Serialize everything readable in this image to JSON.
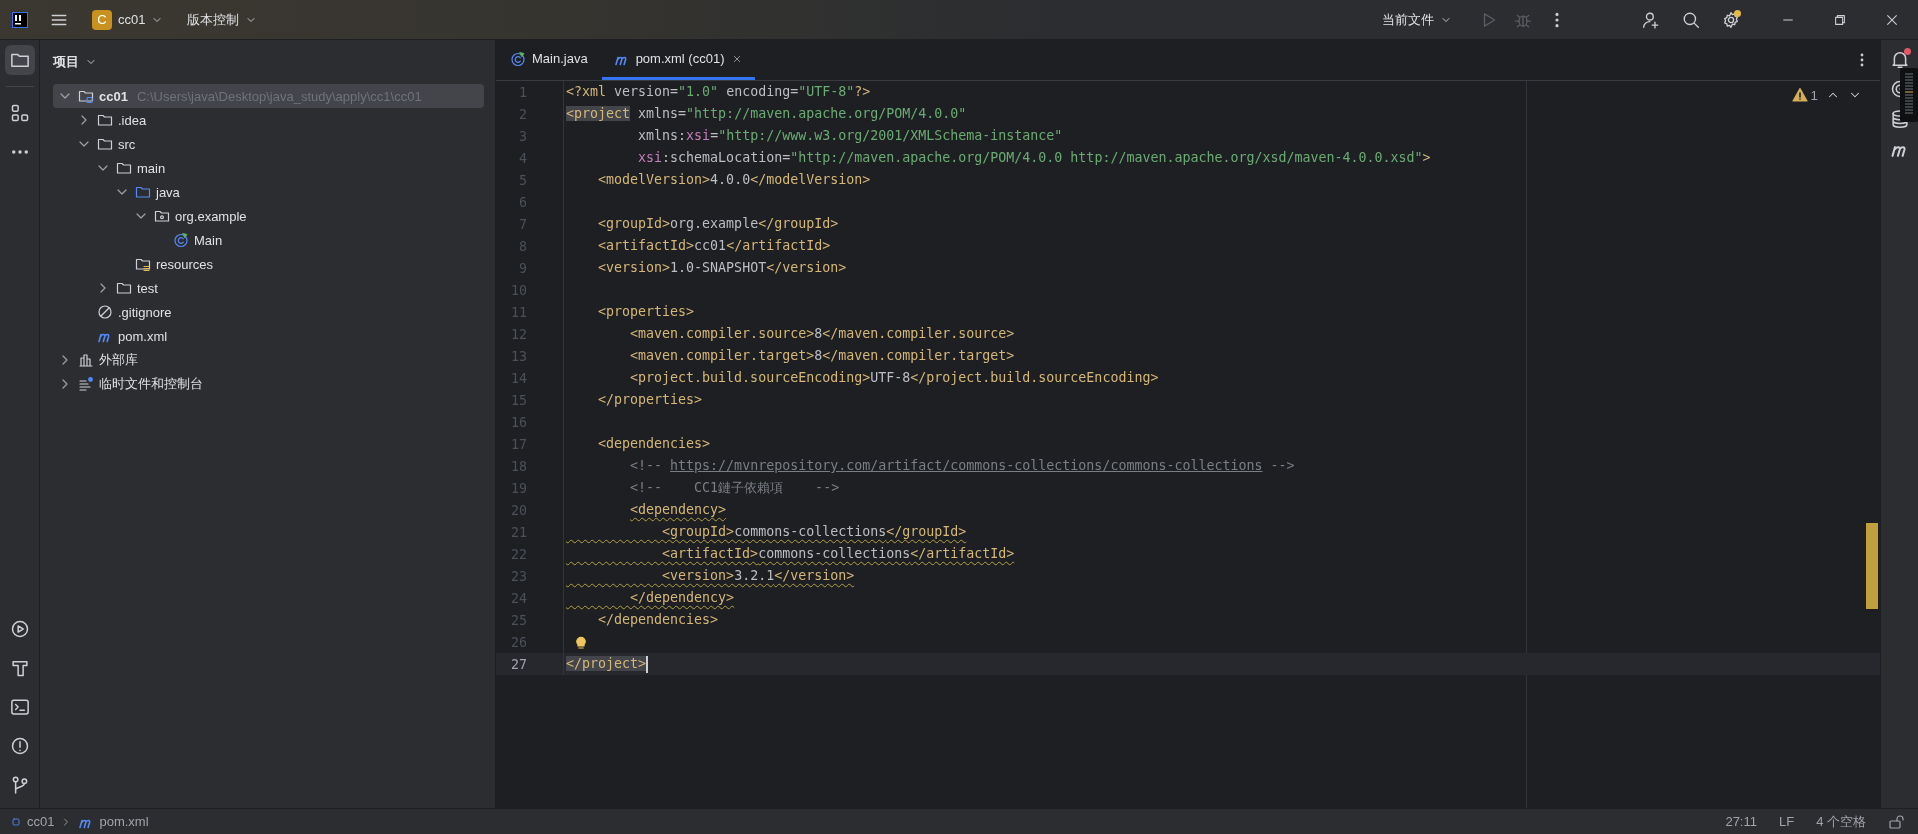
{
  "title_bar": {
    "project": {
      "badge": "C",
      "name": "cc01"
    },
    "vcs_menu": "版本控制",
    "run_config": "当前文件",
    "run_enabled": false,
    "settings_update": true
  },
  "project_panel": {
    "title": "项目",
    "open": true,
    "tree": [
      {
        "kind": "module",
        "label": "cc01",
        "path": "C:\\Users\\java\\Desktop\\java_study\\apply\\cc1\\cc01",
        "expanded": true,
        "selected": true,
        "children": [
          {
            "kind": "folder",
            "label": ".idea",
            "expanded": false,
            "selected": false
          },
          {
            "kind": "folder",
            "label": "src",
            "expanded": true,
            "selected": false,
            "children": [
              {
                "kind": "folder",
                "label": "main",
                "expanded": true,
                "selected": false,
                "children": [
                  {
                    "kind": "source",
                    "label": "java",
                    "expanded": true,
                    "selected": false,
                    "children": [
                      {
                        "kind": "package",
                        "label": "org.example",
                        "expanded": true,
                        "selected": false,
                        "children": [
                          {
                            "kind": "class",
                            "label": "Main",
                            "selected": false
                          }
                        ]
                      }
                    ]
                  },
                  {
                    "kind": "resources",
                    "label": "resources",
                    "selected": false
                  }
                ]
              },
              {
                "kind": "folder",
                "label": "test",
                "expanded": false,
                "selected": false
              }
            ]
          },
          {
            "kind": "gitignore",
            "label": ".gitignore",
            "selected": false
          },
          {
            "kind": "maven",
            "label": "pom.xml",
            "selected": false
          }
        ]
      },
      {
        "kind": "library",
        "label": "外部库",
        "expanded": false,
        "selected": false
      },
      {
        "kind": "scratch",
        "label": "临时文件和控制台",
        "expanded": false,
        "selected": false
      }
    ]
  },
  "editor": {
    "tabs": [
      {
        "kind": "class",
        "label": "Main.java",
        "selected": false,
        "closable": false
      },
      {
        "kind": "maven",
        "label": "pom.xml (cc01)",
        "selected": true,
        "closable": true
      }
    ],
    "warnings": "1",
    "lines": [
      {
        "number": "1",
        "current": false,
        "tokens": [
          {
            "kind": "tag",
            "text": "<?xml "
          },
          {
            "kind": "attr",
            "text": "version="
          },
          {
            "kind": "value",
            "text": "\"1.0\""
          },
          {
            "kind": "attr",
            "text": " encoding="
          },
          {
            "kind": "value",
            "text": "\"UTF-8\""
          },
          {
            "kind": "tag",
            "text": "?>"
          }
        ]
      },
      {
        "number": "2",
        "current": false,
        "tokens": [
          {
            "kind": "tag",
            "text": "<project",
            "match": true
          },
          {
            "kind": "attr",
            "text": " xmlns="
          },
          {
            "kind": "value",
            "text": "\"http://maven.apache.org/POM/4.0.0\""
          }
        ]
      },
      {
        "number": "3",
        "current": false,
        "tokens": [
          {
            "kind": "attr",
            "text": "         xmlns:"
          },
          {
            "kind": "ns",
            "text": "xsi"
          },
          {
            "kind": "attr",
            "text": "="
          },
          {
            "kind": "value",
            "text": "\"http://www.w3.org/2001/XMLSchema-instance\""
          }
        ]
      },
      {
        "number": "4",
        "current": false,
        "tokens": [
          {
            "kind": "ns",
            "text": "         xsi"
          },
          {
            "kind": "attr",
            "text": ":schemaLocation="
          },
          {
            "kind": "value",
            "text": "\"http://maven.apache.org/POM/4.0.0 http://maven.apache.org/xsd/maven-4.0.0.xsd\""
          },
          {
            "kind": "tag",
            "text": ">"
          }
        ]
      },
      {
        "number": "5",
        "current": false,
        "tokens": [
          {
            "kind": "tag",
            "text": "    <modelVersion>"
          },
          {
            "kind": "text",
            "text": "4.0.0"
          },
          {
            "kind": "tag",
            "text": "</modelVersion>"
          }
        ]
      },
      {
        "number": "6",
        "current": false
      },
      {
        "number": "7",
        "current": false,
        "tokens": [
          {
            "kind": "tag",
            "text": "    <groupId>"
          },
          {
            "kind": "text",
            "text": "org.example"
          },
          {
            "kind": "tag",
            "text": "</groupId>"
          }
        ]
      },
      {
        "number": "8",
        "current": false,
        "tokens": [
          {
            "kind": "tag",
            "text": "    <artifactId>"
          },
          {
            "kind": "text",
            "text": "cc01"
          },
          {
            "kind": "tag",
            "text": "</artifactId>"
          }
        ]
      },
      {
        "number": "9",
        "current": false,
        "tokens": [
          {
            "kind": "tag",
            "text": "    <version>"
          },
          {
            "kind": "text",
            "text": "1.0-SNAPSHOT"
          },
          {
            "kind": "tag",
            "text": "</version>"
          }
        ]
      },
      {
        "number": "10",
        "current": false
      },
      {
        "number": "11",
        "current": false,
        "tokens": [
          {
            "kind": "tag",
            "text": "    <properties>"
          }
        ]
      },
      {
        "number": "12",
        "current": false,
        "tokens": [
          {
            "kind": "tag",
            "text": "        <maven.compiler.source>"
          },
          {
            "kind": "text",
            "text": "8"
          },
          {
            "kind": "tag",
            "text": "</maven.compiler.source>"
          }
        ]
      },
      {
        "number": "13",
        "current": false,
        "tokens": [
          {
            "kind": "tag",
            "text": "        <maven.compiler.target>"
          },
          {
            "kind": "text",
            "text": "8"
          },
          {
            "kind": "tag",
            "text": "</maven.compiler.target>"
          }
        ]
      },
      {
        "number": "14",
        "current": false,
        "tokens": [
          {
            "kind": "tag",
            "text": "        <project.build.sourceEncoding>"
          },
          {
            "kind": "text",
            "text": "UTF-8"
          },
          {
            "kind": "tag",
            "text": "</project.build.sourceEncoding>"
          }
        ]
      },
      {
        "number": "15",
        "current": false,
        "tokens": [
          {
            "kind": "tag",
            "text": "    </properties>"
          }
        ]
      },
      {
        "number": "16",
        "current": false
      },
      {
        "number": "17",
        "current": false,
        "tokens": [
          {
            "kind": "tag",
            "text": "    <dependencies>"
          }
        ]
      },
      {
        "number": "18",
        "current": false,
        "tokens": [
          {
            "kind": "comment",
            "text": "        <!-- "
          },
          {
            "kind": "link",
            "text": "https://mvnrepository.com/artifact/commons-collections/commons-collections"
          },
          {
            "kind": "comment",
            "text": " -->"
          }
        ]
      },
      {
        "number": "19",
        "current": false,
        "tokens": [
          {
            "kind": "comment",
            "text": "        <!--    CC1鏈子依賴項    -->"
          }
        ]
      },
      {
        "number": "20",
        "current": false,
        "tokens": [
          {
            "kind": "tag",
            "text": "        <dependency>",
            "warning": true
          }
        ]
      },
      {
        "number": "21",
        "current": false,
        "tokens": [
          {
            "kind": "tag",
            "text": "            <groupId>",
            "warning": true
          },
          {
            "kind": "text",
            "text": "commons-collections",
            "warning": true
          },
          {
            "kind": "tag",
            "text": "</groupId>",
            "warning": true
          }
        ]
      },
      {
        "number": "22",
        "current": false,
        "tokens": [
          {
            "kind": "tag",
            "text": "            <artifactId>",
            "warning": true
          },
          {
            "kind": "text",
            "text": "commons-collections",
            "warning": true
          },
          {
            "kind": "tag",
            "text": "</artifactId>",
            "warning": true
          }
        ]
      },
      {
        "number": "23",
        "current": false,
        "tokens": [
          {
            "kind": "tag",
            "text": "            <version>",
            "warning": true
          },
          {
            "kind": "text",
            "text": "3.2.1",
            "warning": true
          },
          {
            "kind": "tag",
            "text": "</version>",
            "warning": true
          }
        ]
      },
      {
        "number": "24",
        "current": false,
        "tokens": [
          {
            "kind": "tag",
            "text": "        </dependency>",
            "warning": true
          }
        ]
      },
      {
        "number": "25",
        "current": false,
        "tokens": [
          {
            "kind": "tag",
            "text": "    </dependencies>"
          }
        ]
      },
      {
        "number": "26",
        "current": false,
        "bulb": true
      },
      {
        "number": "27",
        "current": true,
        "tokens": [
          {
            "kind": "tag",
            "text": "</project>",
            "match": true
          }
        ]
      }
    ]
  },
  "notifications": {
    "unread": true
  },
  "status_bar": {
    "breadcrumbs": [
      {
        "kind": "module",
        "label": "cc01"
      },
      {
        "kind": "maven",
        "label": "pom.xml"
      }
    ],
    "position": "27:11",
    "line_ending": "LF",
    "indent": "4 个空格",
    "read_only": false
  }
}
